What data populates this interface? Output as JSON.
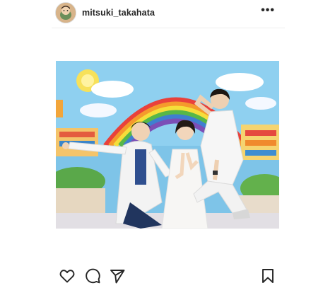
{
  "post": {
    "username": "mitsuki_takahata",
    "more_label": "•••"
  },
  "actions": {
    "like_icon": "heart-icon",
    "comment_icon": "comment-icon",
    "share_icon": "send-icon",
    "save_icon": "bookmark-icon"
  },
  "colors": {
    "text": "#262626",
    "divider": "#efefef",
    "background": "#ffffff"
  }
}
